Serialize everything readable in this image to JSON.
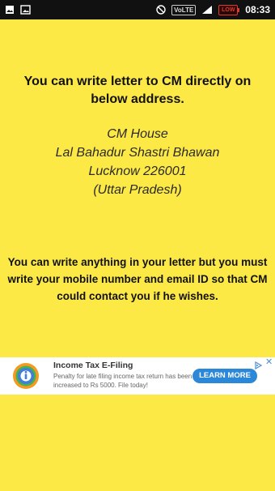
{
  "status_bar": {
    "time": "08:33",
    "network_label": "VoLTE",
    "battery_label": "LOW",
    "icons": [
      "photo-icon",
      "image-icon",
      "do-not-disturb-icon",
      "volte-icon",
      "signal-icon",
      "battery-icon"
    ]
  },
  "main": {
    "heading": "You can write letter to CM directly on below address.",
    "address": {
      "line1": "CM House",
      "line2": "Lal Bahadur Shastri Bhawan",
      "line3": "Lucknow 226001",
      "line4": "(Uttar Pradesh)"
    },
    "note": "You can write anything in your letter but you must write your mobile number and email ID so that CM could contact you if he wishes."
  },
  "ad": {
    "title": "Income Tax E-Filing",
    "description": "Penalty for late filing income tax return has been increased to Rs 5000. File today!",
    "cta": "LEARN MORE",
    "close_symbol": "✕",
    "colors": {
      "cta": "#2b88d9",
      "logo_blue": "#3f7fd6",
      "logo_orange": "#f29a23",
      "logo_green": "#4caf50"
    }
  },
  "colors": {
    "background": "#fde945",
    "status_bar": "#111111"
  }
}
